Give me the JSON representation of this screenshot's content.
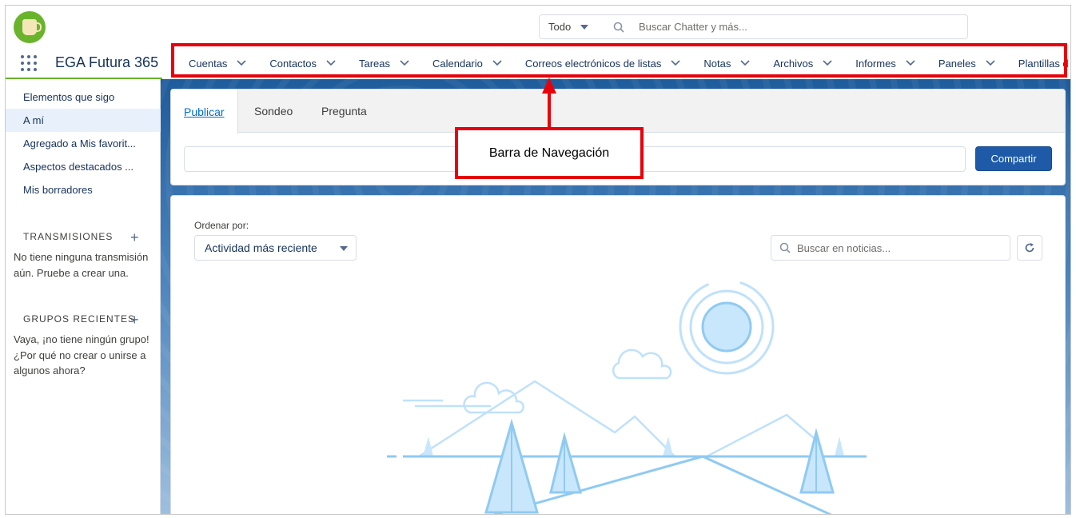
{
  "header": {
    "search_scope": "Todo",
    "search_placeholder": "Buscar Chatter y más..."
  },
  "nav": {
    "app_name": "EGA Futura 365",
    "items": [
      {
        "label": "Cuentas"
      },
      {
        "label": "Contactos"
      },
      {
        "label": "Tareas"
      },
      {
        "label": "Calendario"
      },
      {
        "label": "Correos electrónicos de listas"
      },
      {
        "label": "Notas"
      },
      {
        "label": "Archivos"
      },
      {
        "label": "Informes"
      },
      {
        "label": "Paneles"
      },
      {
        "label": "Plantillas de"
      }
    ]
  },
  "sidebar": {
    "items": [
      {
        "label": "Elementos que sigo"
      },
      {
        "label": "A mí"
      },
      {
        "label": "Agregado a Mis favorit..."
      },
      {
        "label": "Aspectos destacados ..."
      },
      {
        "label": "Mis borradores"
      }
    ],
    "streams_header": "TRANSMISIONES",
    "streams_empty": "No tiene ninguna transmisión aún. Pruebe a crear una.",
    "groups_header": "GRUPOS RECIENTES",
    "groups_empty": "Vaya, ¡no tiene ningún grupo! ¿Por qué no crear o unirse a algunos ahora?"
  },
  "publisher": {
    "tabs": [
      {
        "label": "Publicar"
      },
      {
        "label": "Sondeo"
      },
      {
        "label": "Pregunta"
      }
    ],
    "share_label": "Compartir"
  },
  "annotation": {
    "label": "Barra de Navegación"
  },
  "feed": {
    "sort_label": "Ordenar por:",
    "sort_value": "Actividad más reciente",
    "search_placeholder": "Buscar en noticias..."
  },
  "colors": {
    "brand_green": "#6ab42d",
    "primary_blue": "#1e5aa8",
    "annotation_red": "#e8000b",
    "text_dark": "#16325c"
  }
}
